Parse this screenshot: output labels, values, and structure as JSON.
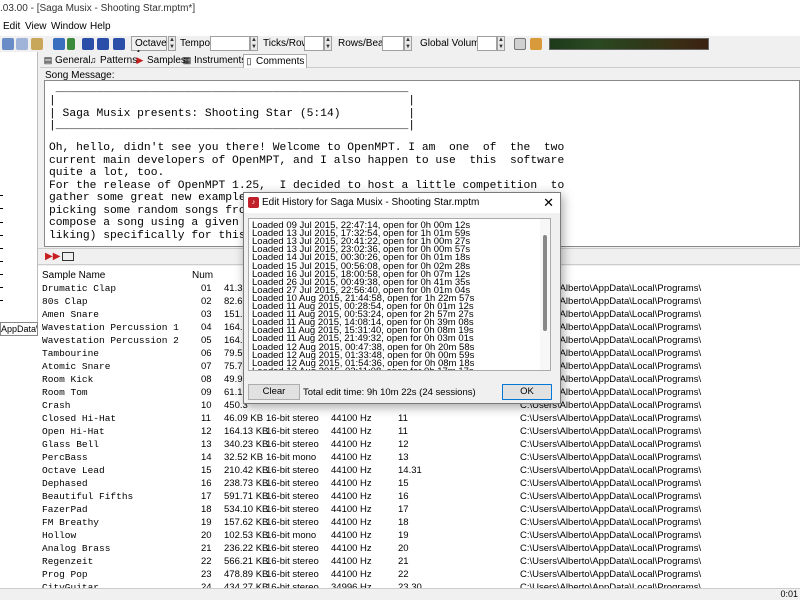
{
  "window": {
    "title": ".03.00 - [Saga Musix - Shooting Star.mptm*]"
  },
  "menu": [
    "Edit",
    "View",
    "Window",
    "Help"
  ],
  "toolbar": {
    "octave": "Octave 4",
    "tempo_label": "Tempo:",
    "ticks_label": "Ticks/Row:",
    "rows_label": "Rows/Beat:",
    "volume_label": "Global Volume:"
  },
  "left_panel": {
    "path": "AppData\\Lo"
  },
  "tabs": [
    {
      "label": "General",
      "icon": "document-icon"
    },
    {
      "label": "Patterns",
      "icon": "note-icon"
    },
    {
      "label": "Samples",
      "icon": "waveform-icon"
    },
    {
      "label": "Instruments",
      "icon": "keyboard-icon"
    },
    {
      "label": "Comments",
      "icon": "comment-icon"
    }
  ],
  "song_message": {
    "label": "Song Message:",
    "lines": [
      " ____________________________________________________",
      "|                                                    |",
      "| Saga Musix presents: Shooting Star (5:14)          |",
      "|____________________________________________________|",
      "",
      "Oh, hello, didn't see you there! Welcome to OpenMPT. I am  one  of  the  two",
      "current main developers of OpenMPT, and I also happen to use  this  software",
      "quite a lot, too.",
      "For the release of OpenMPT 1.25,  I decided to host a little competition  to",
      "gather some great new example so",
      "picking some random songs from m",
      "compose a song using a given sam",
      "liking) specifically for this re"
    ]
  },
  "samples_table": {
    "headers": [
      "Sample Name",
      "Num"
    ],
    "rows": [
      {
        "name": "Drumatic Clap",
        "num": "01",
        "size": "41.3",
        "type": "",
        "rate": "",
        "note": "",
        "path": "C:\\Users\\Alberto\\AppData\\Local\\Programs\\"
      },
      {
        "name": "80s Clap",
        "num": "02",
        "size": "82.6",
        "type": "",
        "rate": "",
        "note": "",
        "path": "C:\\Users\\Alberto\\AppData\\Local\\Programs\\"
      },
      {
        "name": "Amen Snare",
        "num": "03",
        "size": "151.8",
        "type": "",
        "rate": "",
        "note": "",
        "path": "C:\\Users\\Alberto\\AppData\\Local\\Programs\\"
      },
      {
        "name": "Wavestation Percussion 1",
        "num": "04",
        "size": "164.9",
        "type": "",
        "rate": "",
        "note": "",
        "path": "C:\\Users\\Alberto\\AppData\\Local\\Programs\\"
      },
      {
        "name": "Wavestation Percussion 2",
        "num": "05",
        "size": "164.9",
        "type": "",
        "rate": "",
        "note": "",
        "path": "C:\\Users\\Alberto\\AppData\\Local\\Programs\\"
      },
      {
        "name": "Tambourine",
        "num": "06",
        "size": "79.5",
        "type": "",
        "rate": "",
        "note": "",
        "path": "C:\\Users\\Alberto\\AppData\\Local\\Programs\\"
      },
      {
        "name": "Atomic Snare",
        "num": "07",
        "size": "75.7",
        "type": "",
        "rate": "",
        "note": "",
        "path": "C:\\Users\\Alberto\\AppData\\Local\\Programs\\"
      },
      {
        "name": "Room Kick",
        "num": "08",
        "size": "49.9",
        "type": "",
        "rate": "",
        "note": "",
        "path": "C:\\Users\\Alberto\\AppData\\Local\\Programs\\"
      },
      {
        "name": "Room Tom",
        "num": "09",
        "size": "61.1",
        "type": "",
        "rate": "",
        "note": "",
        "path": "C:\\Users\\Alberto\\AppData\\Local\\Programs\\"
      },
      {
        "name": "Crash",
        "num": "10",
        "size": "450.3",
        "type": "",
        "rate": "",
        "note": "",
        "path": "C:\\Users\\Alberto\\AppData\\Local\\Programs\\"
      },
      {
        "name": "Closed Hi-Hat",
        "num": "11",
        "size": "46.09 KB",
        "type": "16-bit stereo",
        "rate": "44100 Hz",
        "note": "11",
        "path": "C:\\Users\\Alberto\\AppData\\Local\\Programs\\"
      },
      {
        "name": "Open Hi-Hat",
        "num": "12",
        "size": "164.13 KB",
        "type": "16-bit stereo",
        "rate": "44100 Hz",
        "note": "11",
        "path": "C:\\Users\\Alberto\\AppData\\Local\\Programs\\"
      },
      {
        "name": "Glass Bell",
        "num": "13",
        "size": "340.23 KB",
        "type": "16-bit stereo",
        "rate": "44100 Hz",
        "note": "12",
        "path": "C:\\Users\\Alberto\\AppData\\Local\\Programs\\"
      },
      {
        "name": "PercBass",
        "num": "14",
        "size": "32.52 KB",
        "type": "16-bit mono",
        "rate": "44100 Hz",
        "note": "13",
        "path": "C:\\Users\\Alberto\\AppData\\Local\\Programs\\"
      },
      {
        "name": "Octave Lead",
        "num": "15",
        "size": "210.42 KB",
        "type": "16-bit stereo",
        "rate": "44100 Hz",
        "note": "14.31",
        "path": "C:\\Users\\Alberto\\AppData\\Local\\Programs\\"
      },
      {
        "name": "Dephased",
        "num": "16",
        "size": "238.73 KB",
        "type": "16-bit stereo",
        "rate": "44100 Hz",
        "note": "15",
        "path": "C:\\Users\\Alberto\\AppData\\Local\\Programs\\"
      },
      {
        "name": "Beautiful Fifths",
        "num": "17",
        "size": "591.71 KB",
        "type": "16-bit stereo",
        "rate": "44100 Hz",
        "note": "16",
        "path": "C:\\Users\\Alberto\\AppData\\Local\\Programs\\"
      },
      {
        "name": "FazerPad",
        "num": "18",
        "size": "534.10 KB",
        "type": "16-bit stereo",
        "rate": "44100 Hz",
        "note": "17",
        "path": "C:\\Users\\Alberto\\AppData\\Local\\Programs\\"
      },
      {
        "name": "FM Breathy",
        "num": "19",
        "size": "157.62 KB",
        "type": "16-bit stereo",
        "rate": "44100 Hz",
        "note": "18",
        "path": "C:\\Users\\Alberto\\AppData\\Local\\Programs\\"
      },
      {
        "name": "Hollow",
        "num": "20",
        "size": "102.53 KB",
        "type": "16-bit mono",
        "rate": "44100 Hz",
        "note": "19",
        "path": "C:\\Users\\Alberto\\AppData\\Local\\Programs\\"
      },
      {
        "name": "Analog Brass",
        "num": "21",
        "size": "236.22 KB",
        "type": "16-bit stereo",
        "rate": "44100 Hz",
        "note": "20",
        "path": "C:\\Users\\Alberto\\AppData\\Local\\Programs\\"
      },
      {
        "name": "Regenzeit",
        "num": "22",
        "size": "566.21 KB",
        "type": "16-bit stereo",
        "rate": "44100 Hz",
        "note": "21",
        "path": "C:\\Users\\Alberto\\AppData\\Local\\Programs\\"
      },
      {
        "name": "Prog Pop",
        "num": "23",
        "size": "478.89 KB",
        "type": "16-bit stereo",
        "rate": "44100 Hz",
        "note": "22",
        "path": "C:\\Users\\Alberto\\AppData\\Local\\Programs\\"
      },
      {
        "name": "CityGuitar",
        "num": "24",
        "size": "434.27 KB",
        "type": "16-bit stereo",
        "rate": "34996 Hz",
        "note": "23.30",
        "path": "C:\\Users\\Alberto\\AppData\\Local\\Programs\\"
      }
    ]
  },
  "dialog": {
    "title": "Edit History for Saga Musix - Shooting Star.mptm",
    "entries": [
      "Loaded 09 Jul 2015, 22:47:14, open for 0h 00m 12s",
      "Loaded 13 Jul 2015, 17:32:54, open for 1h 01m 59s",
      "Loaded 13 Jul 2015, 20:41:22, open for 1h 00m 27s",
      "Loaded 13 Jul 2015, 23:02:36, open for 0h 00m 57s",
      "Loaded 14 Jul 2015, 00:30:26, open for 0h 01m 18s",
      "Loaded 15 Jul 2015, 00:56:08, open for 0h 02m 28s",
      "Loaded 16 Jul 2015, 18:00:58, open for 0h 07m 12s",
      "Loaded 26 Jul 2015, 00:49:38, open for 0h 41m 35s",
      "Loaded 27 Jul 2015, 22:56:40, open for 0h 01m 04s",
      "Loaded 10 Aug 2015, 21:44:58, open for 1h 22m 57s",
      "Loaded 11 Aug 2015, 00:28:54, open for 0h 01m 12s",
      "Loaded 11 Aug 2015, 00:53:24, open for 2h 57m 27s",
      "Loaded 11 Aug 2015, 14:08:14, open for 0h 39m 08s",
      "Loaded 11 Aug 2015, 15:31:40, open for 0h 08m 19s",
      "Loaded 11 Aug 2015, 21:49:32, open for 0h 03m 01s",
      "Loaded 12 Aug 2015, 00:47:38, open for 0h 20m 58s",
      "Loaded 12 Aug 2015, 01:33:48, open for 0h 00m 59s",
      "Loaded 12 Aug 2015, 01:54:36, open for 0h 08m 18s",
      "Loaded 12 Aug 2015, 02:11:08, open for 0h 17m 17s"
    ],
    "clear_label": "Clear",
    "total_text": "Total edit time: 9h 10m 22s (24 sessions)",
    "ok_label": "OK"
  },
  "status": {
    "right_text": "0:01"
  }
}
